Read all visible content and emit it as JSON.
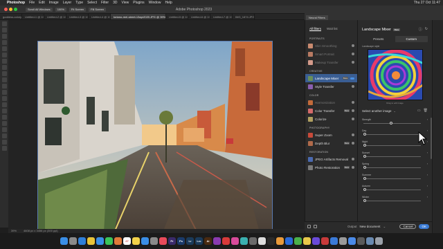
{
  "menubar": {
    "app": "Photoshop",
    "items": [
      "File",
      "Edit",
      "Image",
      "Layer",
      "Type",
      "Select",
      "Filter",
      "3D",
      "View",
      "Plugins",
      "Window",
      "Help"
    ],
    "clock": "Thu 27 Oct 11:47"
  },
  "optionsbar": {
    "buttons": [
      "Scroll All Windows",
      "100%",
      "Fit Screen",
      "Fill Screen"
    ]
  },
  "document": {
    "title": "Adobe Photoshop 2023",
    "tabs": [
      "goddess-coloryou.psd",
      "Untitled-1 @ 100%",
      "Untitled-2 @ 100%",
      "Untitled-3 @ 100%",
      "Untitled-4 @ 100%",
      "toriano-reel-street-13apr2020.JPG @ 39% (Layer 0, RGB/8)",
      "Untitled-5 @ 100%",
      "Untitled-6 @ 100%",
      "Untitled-7 @ 100%",
      "IMG_1874.JPG @ 100%"
    ]
  },
  "status": {
    "zoom": "39%",
    "dimensions": "4608 px x 3456 px (300 ppi)"
  },
  "neural_filters": {
    "header_tab": "Neural Filters",
    "tabs": {
      "all": "All filters",
      "wait": "Wait list"
    },
    "sections": [
      {
        "title": "PORTRAITS",
        "items": [
          {
            "label": "Skin Smoothing",
            "dim": true,
            "thumb": "#c98a6f"
          },
          {
            "label": "Smart Portrait",
            "dim": true,
            "thumb": "#b87a62"
          },
          {
            "label": "Makeup Transfer",
            "dim": true,
            "thumb": "#d49a8a"
          }
        ]
      },
      {
        "title": "CREATIVE",
        "items": [
          {
            "label": "Landscape Mixer",
            "dim": false,
            "selected": true,
            "badge": "Beta",
            "toggle": true,
            "thumb": "#6a8f5a"
          },
          {
            "label": "Style Transfer",
            "dim": false,
            "thumb": "#8a5fb0"
          }
        ]
      },
      {
        "title": "COLOR",
        "items": [
          {
            "label": "Harmonization",
            "dim": true,
            "thumb": "#c26a3a"
          },
          {
            "label": "Color Transfer",
            "dim": false,
            "badge": "Beta",
            "thumb": "#d46a6a"
          },
          {
            "label": "Colorize",
            "dim": false,
            "thumb": "#b0a060"
          }
        ]
      },
      {
        "title": "PHOTOGRAPHY",
        "items": [
          {
            "label": "Super Zoom",
            "dim": false,
            "thumb": "#c84a3a"
          },
          {
            "label": "Depth Blur",
            "dim": false,
            "badge": "Beta",
            "thumb": "#b06a4a"
          }
        ]
      },
      {
        "title": "RESTORATION",
        "items": [
          {
            "label": "JPEG Artifacts Removal",
            "dim": false,
            "thumb": "#4a6ab0"
          },
          {
            "label": "Photo Restoration",
            "dim": false,
            "badge": "Beta",
            "thumb": "#7a7a7a"
          }
        ]
      }
    ]
  },
  "settings": {
    "title": "Landscape Mixer",
    "badge": "Beta",
    "tabs": {
      "presets": "Presets",
      "custom": "Custom"
    },
    "style_label": "Landscape style",
    "style_caption": "Drag to edit image",
    "select_image": "Select another image",
    "sliders": [
      {
        "label": "Strength",
        "value": 0.45,
        "knob": true
      },
      {
        "label": "Day",
        "value": 0.0,
        "knob": true
      },
      {
        "label": "Night",
        "value": 0.0,
        "knob": true
      },
      {
        "label": "Sunset",
        "value": 0.0,
        "knob": true
      },
      {
        "label": "Spring",
        "value": 0.0,
        "knob": true
      },
      {
        "label": "Summer",
        "value": 0.0,
        "knob": true
      },
      {
        "label": "Autumn",
        "value": 0.0,
        "knob": true
      },
      {
        "label": "Winter",
        "value": 0.0,
        "knob": true
      }
    ]
  },
  "footer": {
    "output_label": "Output",
    "output_value": "New document",
    "cancel": "Cancel",
    "ok": "OK"
  },
  "dock": {
    "icons": [
      {
        "name": "finder-icon",
        "color": "#3a8ee6",
        "label": ""
      },
      {
        "name": "launchpad-icon",
        "color": "#8a8a8a",
        "label": ""
      },
      {
        "name": "safari-icon",
        "color": "#2f7fd9",
        "label": ""
      },
      {
        "name": "chrome-icon",
        "color": "#e8c33a",
        "label": ""
      },
      {
        "name": "mail-icon",
        "color": "#3a8ee6",
        "label": ""
      },
      {
        "name": "messages-icon",
        "color": "#3ac45a",
        "label": ""
      },
      {
        "name": "photos-icon",
        "color": "#e07a3a",
        "label": ""
      },
      {
        "name": "calendar-icon",
        "color": "#ffffff",
        "label": "27"
      },
      {
        "name": "notes-icon",
        "color": "#f2d24a",
        "label": ""
      },
      {
        "name": "appstore-icon",
        "color": "#3a8ee6",
        "label": ""
      },
      {
        "name": "settings-icon",
        "color": "#8a8a8a",
        "label": ""
      },
      {
        "name": "music-icon",
        "color": "#e84a5a",
        "label": ""
      },
      {
        "name": "premiere-icon",
        "color": "#3a2a6a",
        "label": "Pr"
      },
      {
        "name": "photoshop-icon",
        "color": "#1a3a6a",
        "label": "Ps"
      },
      {
        "name": "lightroom-icon",
        "color": "#1a3a5a",
        "label": "Lr"
      },
      {
        "name": "lrc-icon",
        "color": "#1a3a5a",
        "label": "Lrc"
      },
      {
        "name": "illustrator-icon",
        "color": "#4a2a10",
        "label": "Ai"
      },
      {
        "name": "app-purple-icon",
        "color": "#8a3ab0",
        "label": ""
      },
      {
        "name": "app-red-icon",
        "color": "#d83a3a",
        "label": ""
      },
      {
        "name": "app-pink-icon",
        "color": "#d84a9a",
        "label": ""
      },
      {
        "name": "app-teal-icon",
        "color": "#3ab0b0",
        "label": ""
      },
      {
        "name": "app-gray-icon",
        "color": "#6a6a6a",
        "label": ""
      },
      {
        "name": "app-white-icon",
        "color": "#dddddd",
        "label": ""
      },
      {
        "name": "app-dark-icon",
        "color": "#2a2a2a",
        "label": ""
      },
      {
        "name": "app-orange-icon",
        "color": "#e89a3a",
        "label": ""
      },
      {
        "name": "app-blue2-icon",
        "color": "#2a6ad8",
        "label": ""
      },
      {
        "name": "app-green2-icon",
        "color": "#4ab04a",
        "label": ""
      },
      {
        "name": "app-yellow-icon",
        "color": "#e8c84a",
        "label": ""
      },
      {
        "name": "app-purple2-icon",
        "color": "#6a4ad8",
        "label": ""
      },
      {
        "name": "app-red2-icon",
        "color": "#c83a3a",
        "label": ""
      },
      {
        "name": "app-blue3-icon",
        "color": "#3a7ad8",
        "label": ""
      },
      {
        "name": "app-gray2-icon",
        "color": "#9a9a9a",
        "label": ""
      },
      {
        "name": "app-blue4-icon",
        "color": "#4a8ae8",
        "label": ""
      },
      {
        "name": "app-gray3-icon",
        "color": "#5a5a5a",
        "label": ""
      },
      {
        "name": "downloads-icon",
        "color": "#6a8ab0",
        "label": ""
      },
      {
        "name": "trash-icon",
        "color": "#9aa0a8",
        "label": ""
      }
    ]
  }
}
